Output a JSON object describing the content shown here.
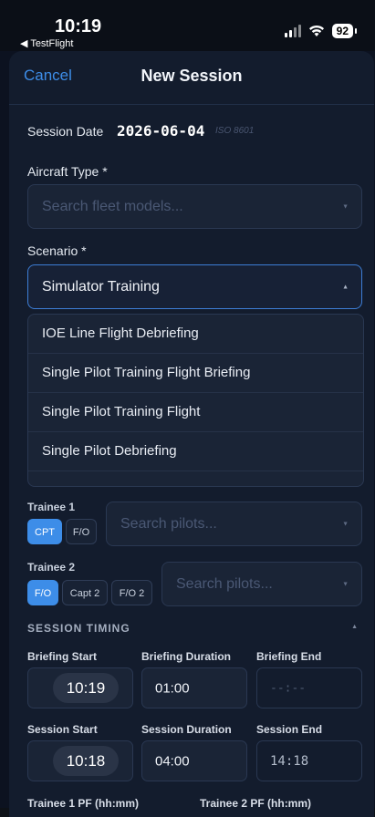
{
  "status_bar": {
    "time": "10:19",
    "back_app": "◀ TestFlight",
    "battery": "92"
  },
  "nav": {
    "cancel": "Cancel",
    "title": "New Session"
  },
  "session_date": {
    "label": "Session Date",
    "value": "2026-06-04",
    "format": "ISO 8601"
  },
  "aircraft": {
    "label": "Aircraft Type *",
    "placeholder": "Search fleet models..."
  },
  "scenario": {
    "label": "Scenario *",
    "value": "Simulator Training",
    "options": [
      "IOE Line Flight Debriefing",
      "Single Pilot Training Flight Briefing",
      "Single Pilot Training Flight",
      "Single Pilot Debriefing"
    ]
  },
  "trainee1": {
    "label": "Trainee 1",
    "roles": [
      "CPT",
      "F/O"
    ],
    "active_role": "CPT",
    "placeholder": "Search pilots..."
  },
  "trainee2": {
    "label": "Trainee 2",
    "roles": [
      "F/O",
      "Capt 2",
      "F/O 2"
    ],
    "active_role": "F/O",
    "placeholder": "Search pilots..."
  },
  "timing": {
    "header": "SESSION TIMING",
    "briefing_start_label": "Briefing Start",
    "briefing_start": "10:19",
    "briefing_duration_label": "Briefing Duration",
    "briefing_duration": "01:00",
    "briefing_end_label": "Briefing End",
    "briefing_end": "--:--",
    "session_start_label": "Session Start",
    "session_start": "10:18",
    "session_duration_label": "Session Duration",
    "session_duration": "04:00",
    "session_end_label": "Session End",
    "session_end": "14:18",
    "trainee1_pf_label": "Trainee 1 PF (hh:mm)",
    "trainee2_pf_label": "Trainee 2 PF (hh:mm)"
  }
}
